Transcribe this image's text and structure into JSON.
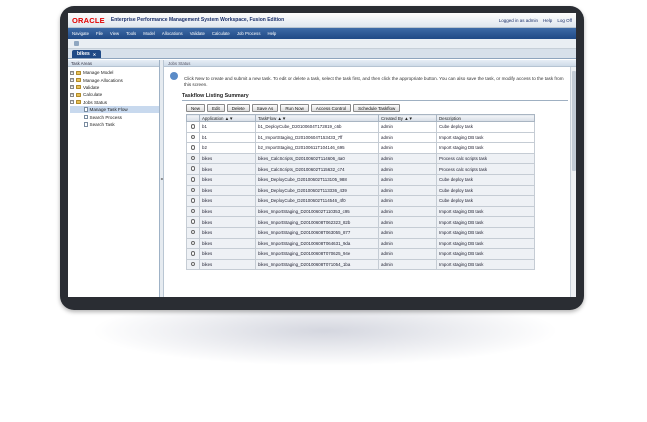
{
  "header": {
    "logo": "ORACLE",
    "title": "Enterprise Performance Management System Workspace, Fusion Edition",
    "links": [
      "Logged in as admin",
      "Help",
      "Log Off"
    ]
  },
  "menu": [
    "Navigate",
    "File",
    "View",
    "Tools",
    "Model",
    "Allocations",
    "Validate",
    "Calculate",
    "Job Process",
    "Help"
  ],
  "tab": {
    "label": "bikes",
    "close": "✕"
  },
  "left": {
    "heading": "Task Areas",
    "items": [
      "Manage Model",
      "Manage Allocations",
      "Validate",
      "Calculate",
      "Jobs Status",
      "Manage Task Flow",
      "Search Process",
      "Search Task"
    ]
  },
  "main": {
    "heading": "Jobs Status",
    "instructions": "Click New to create and submit a new task. To edit or delete a task, select the task first, and then click the appropriate button. You can also save the task, or modify access to the task from this screen.",
    "section": "Taskflow Listing Summary",
    "buttons": [
      "New",
      "Edit",
      "Delete",
      "Save As",
      "Run Now",
      "Access Control",
      "Schedule Taskflow"
    ],
    "columns": [
      "Application",
      "TaskFlow",
      "Created By",
      "Description"
    ],
    "rows": [
      [
        "b1",
        "b1_DeployCube_D20100604T172819_c6b",
        "admin",
        "Cube deploy task"
      ],
      [
        "b1",
        "b1_ImportStaging_D20100604T153433_7ff",
        "admin",
        "Import staging DB task"
      ],
      [
        "b2",
        "b2_ImportStaging_D20100611T104146_695",
        "admin",
        "Import staging DB task"
      ],
      [
        "bikes",
        "bikes_CalcScripts_D20100602T114606_4a0",
        "admin",
        "Process calc scripts task"
      ],
      [
        "bikes",
        "bikes_CalcScripts_D20100602T115632_c74",
        "admin",
        "Process calc scripts task"
      ],
      [
        "bikes",
        "bikes_DeployCube_D20100602T113105_988",
        "admin",
        "Cube deploy task"
      ],
      [
        "bikes",
        "bikes_DeployCube_D20100602T113336_439",
        "admin",
        "Cube deploy task"
      ],
      [
        "bikes",
        "bikes_DeployCube_D20100602T114546_4f0",
        "admin",
        "Cube deploy task"
      ],
      [
        "bikes",
        "bikes_ImportStaging_D20100602T110353_c95",
        "admin",
        "Import staging DB task"
      ],
      [
        "bikes",
        "bikes_ImportStaging_D20100608T062323_82b",
        "admin",
        "Import staging DB task"
      ],
      [
        "bikes",
        "bikes_ImportStaging_D20100608T063055_877",
        "admin",
        "Import staging DB task"
      ],
      [
        "bikes",
        "bikes_ImportStaging_D20100608T064631_9da",
        "admin",
        "Import staging DB task"
      ],
      [
        "bikes",
        "bikes_ImportStaging_D20100608T070625_94e",
        "admin",
        "Import staging DB task"
      ],
      [
        "bikes",
        "bikes_ImportStaging_D20100608T071054_1ba",
        "admin",
        "Import staging DB task"
      ]
    ]
  }
}
